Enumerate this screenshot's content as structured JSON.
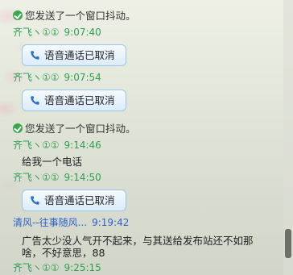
{
  "messages": {
    "sys1": "您发送了一个窗口抖动。",
    "s1_name": "齐飞ヽ①①",
    "s1_time": "9:07:40",
    "call1": "语音通话已取消",
    "s2_name": "齐飞ヽ①①",
    "s2_time": "9:07:54",
    "call2": "语音通话已取消",
    "sys2": "您发送了一个窗口抖动。",
    "s3_name": "齐飞ヽ①①",
    "s3_time": "9:14:46",
    "text1": "给我一个电话",
    "s4_name": "齐飞ヽ①①",
    "s4_time": "9:14:50",
    "call3": "语音通话已取消",
    "s5_name": "清风--往事随风...",
    "s5_time": "9:19:42",
    "text2_line1": "广告太少没人气开不起来，与其送给发布站还不如那",
    "text2_line2": "啥，不好意思，88",
    "s6_name": "齐飞ヽ①①",
    "s6_time": "9:25:15"
  },
  "icons": {
    "check": "check-circle-icon",
    "phone": "phone-icon"
  },
  "colors": {
    "green_name": "#2f9f52",
    "blue_name": "#2d62c8",
    "check": "#3aa84a",
    "bubble_border": "#9cc4e6"
  }
}
